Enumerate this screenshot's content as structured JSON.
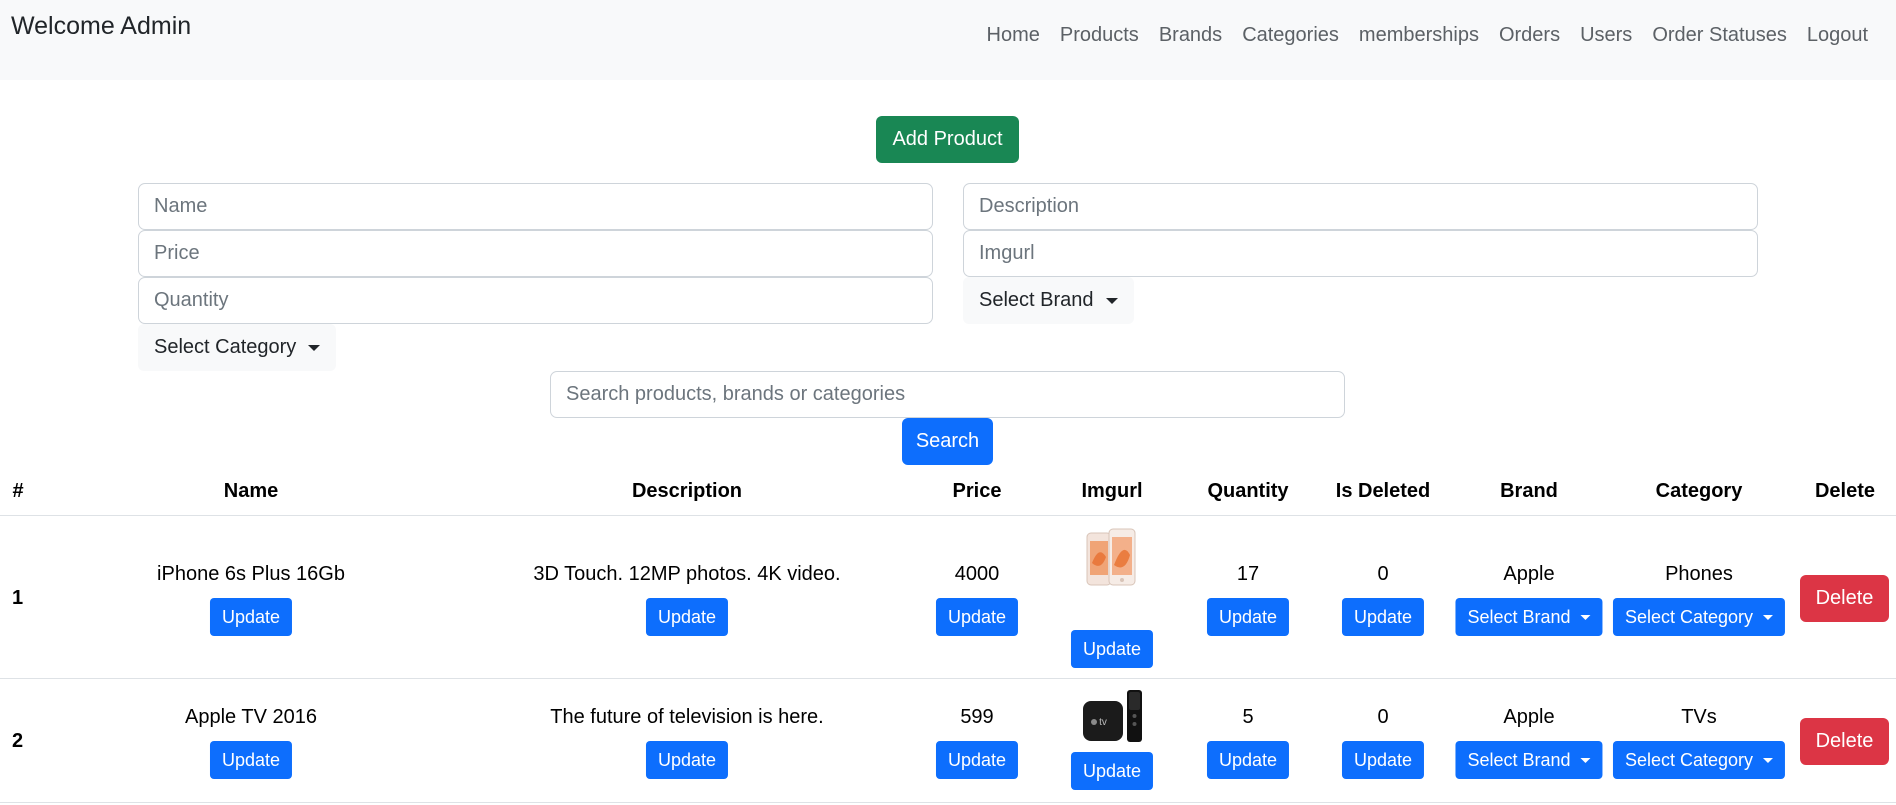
{
  "nav": {
    "brand": "Welcome Admin",
    "links": [
      "Home",
      "Products",
      "Brands",
      "Categories",
      "memberships",
      "Orders",
      "Users",
      "Order Statuses",
      "Logout"
    ]
  },
  "form": {
    "add_label": "Add Product",
    "name_placeholder": "Name",
    "description_placeholder": "Description",
    "price_placeholder": "Price",
    "imgurl_placeholder": "Imgurl",
    "quantity_placeholder": "Quantity",
    "brand_label": "Select Brand",
    "category_label": "Select Category"
  },
  "search": {
    "placeholder": "Search products, brands or categories",
    "button": "Search"
  },
  "table": {
    "headers": [
      "#",
      "Name",
      "Description",
      "Price",
      "Imgurl",
      "Quantity",
      "Is Deleted",
      "Brand",
      "Category",
      "Delete"
    ],
    "update_label": "Update",
    "select_brand_label": "Select Brand",
    "select_category_label": "Select Category",
    "delete_label": "Delete",
    "rows": [
      {
        "num": "1",
        "name": "iPhone 6s Plus 16Gb",
        "description": "3D Touch. 12MP photos. 4K video.",
        "price": "4000",
        "quantity": "17",
        "is_deleted": "0",
        "brand": "Apple",
        "category": "Phones",
        "image_icon": "iphone-product-image"
      },
      {
        "num": "2",
        "name": "Apple TV 2016",
        "description": "The future of television is here.",
        "price": "599",
        "quantity": "5",
        "is_deleted": "0",
        "brand": "Apple",
        "category": "TVs",
        "image_icon": "apple-tv-product-image"
      }
    ]
  },
  "colors": {
    "primary": "#0d6efd",
    "success": "#198754",
    "danger": "#dc3545",
    "navbar_bg": "#f8f9fa"
  }
}
